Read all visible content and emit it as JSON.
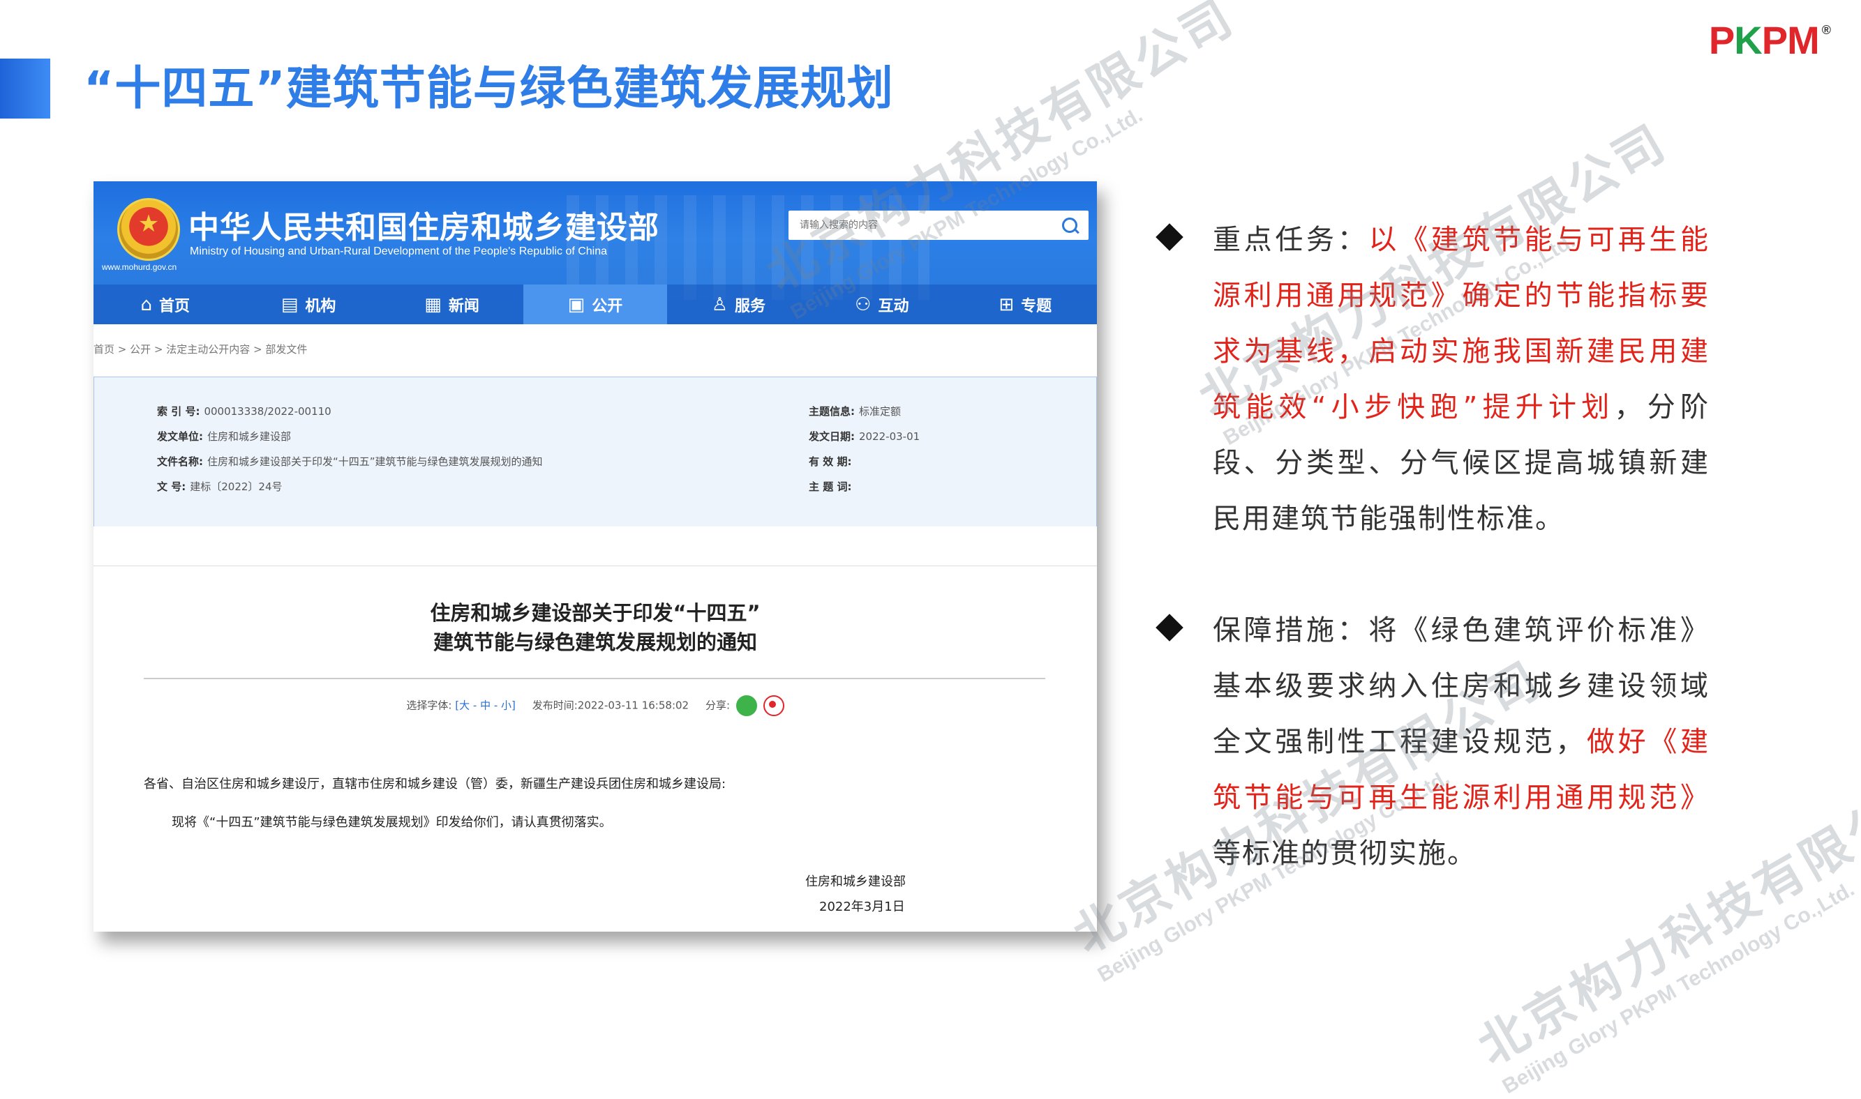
{
  "slide": {
    "title": "“十四五”建筑节能与绿色建筑发展规划",
    "accent_color": "#2f7ee8",
    "logo": {
      "part1": "P",
      "part2": "K",
      "part3": "PM",
      "registered": "®"
    }
  },
  "gov_site": {
    "name_cn": "中华人民共和国住房和城乡建设部",
    "name_en": "Ministry of Housing and Urban-Rural Development of the People's Republic of China",
    "url": "www.mohurd.gov.cn",
    "emblem_icon": "national-emblem",
    "search": {
      "placeholder": "请输入搜索的内容",
      "icon": "search-icon"
    },
    "nav": [
      {
        "label": "首页",
        "icon": "⌂"
      },
      {
        "label": "机构",
        "icon": "▤"
      },
      {
        "label": "新闻",
        "icon": "▦"
      },
      {
        "label": "公开",
        "icon": "▣"
      },
      {
        "label": "服务",
        "icon": "♙"
      },
      {
        "label": "互动",
        "icon": "⚇"
      },
      {
        "label": "专题",
        "icon": "⊞"
      }
    ],
    "active_nav": "公开",
    "breadcrumb": "首页 > 公开 > 法定主动公开内容 > 部发文件",
    "meta": {
      "index_label": "索 引 号:",
      "index_value": "000013338/2022-00110",
      "topic_label": "主题信息:",
      "topic_value": "标准定额",
      "issuer_label": "发文单位:",
      "issuer_value": "住房和城乡建设部",
      "date_label": "发文日期:",
      "date_value": "2022-03-01",
      "filename_label": "文件名称:",
      "filename_value": "住房和城乡建设部关于印发“十四五”建筑节能与绿色建筑发展规划的通知",
      "validity_label": "有 效 期:",
      "validity_value": "",
      "docno_label": "文     号:",
      "docno_value": "建标〔2022〕24号",
      "keywords_label": "主 题 词:",
      "keywords_value": ""
    },
    "doc": {
      "title_line1": "住房和城乡建设部关于印发“十四五”",
      "title_line2": "建筑节能与绿色建筑发展规划的通知",
      "font_label": "选择字体:",
      "font_options": "[大 - 中 - 小]",
      "publish_label": "发布时间:",
      "publish_time": "2022-03-11 16:58:02",
      "share_label": "分享:",
      "body_line1": "各省、自治区住房和城乡建设厅，直辖市住房和城乡建设（管）委，新疆生产建设兵团住房和城乡建设局:",
      "body_line2": "现将《“十四五”建筑节能与绿色建筑发展规划》印发给你们，请认真贯彻落实。",
      "signer": "住房和城乡建设部",
      "sign_date": "2022年3月1日"
    }
  },
  "bullets": [
    {
      "prefix": "重点任务：",
      "red": "以《建筑节能与可再生能源利用通用规范》确定的节能指标要求为基线，启动实施我国新建民用建筑能效“小步快跑”提升计划",
      "rest": "，分阶段、分类型、分气候区提高城镇新建民用建筑节能强制性标准。"
    },
    {
      "prefix": "保障措施：将《绿色建筑评价标准》基本级要求纳入住房和城乡建设领域全文强制性工程建设规范，",
      "red": "做好《建筑节能与可再生能源利用通用规范》",
      "rest": "等标准的贯彻实施。"
    }
  ],
  "watermark": {
    "cn": "北京构力科技有限公司",
    "en": "Beijing Glory PKPM Technology Co.,Ltd."
  }
}
